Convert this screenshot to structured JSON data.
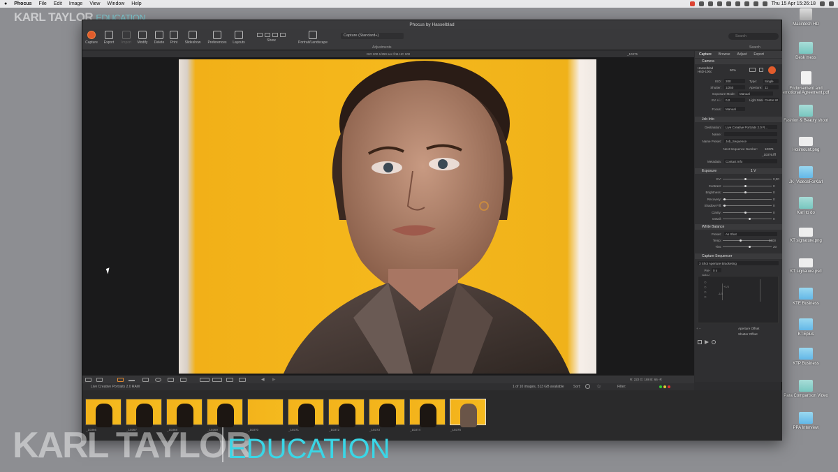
{
  "menubar": {
    "apple": "",
    "app": "Phocus",
    "items": [
      "File",
      "Edit",
      "Image",
      "View",
      "Window",
      "Help"
    ],
    "clock": "Thu 15 Apr  15:26:18"
  },
  "watermark": {
    "top_name": "KARL TAYLOR",
    "top_edu": "EDUCATION",
    "big_name": "KARL TAYLOR",
    "big_edu": "EDUCATION"
  },
  "desktop": [
    {
      "label": "Macintosh HD",
      "kind": "hd"
    },
    {
      "label": "Desk mess",
      "kind": "folder teal"
    },
    {
      "label": "Endorsement and\nemotional Agreement.pdf",
      "kind": "doc"
    },
    {
      "label": "Fashion & Beauty shoot",
      "kind": "folder teal"
    },
    {
      "label": "Holimount.png",
      "kind": "png"
    },
    {
      "label": "JK_VideosForKarl",
      "kind": "folder"
    },
    {
      "label": "Karl to do",
      "kind": "folder teal"
    },
    {
      "label": "KT signature.png",
      "kind": "png"
    },
    {
      "label": "KT signature.psd",
      "kind": "png"
    },
    {
      "label": "KTE Business",
      "kind": "folder"
    },
    {
      "label": "KTEplus",
      "kind": "folder"
    },
    {
      "label": "KTP Business",
      "kind": "folder"
    },
    {
      "label": "Para Comparison Video",
      "kind": "folder teal"
    },
    {
      "label": "PPA Interview",
      "kind": "folder"
    }
  ],
  "window": {
    "title": "Phocus by Hasselblad"
  },
  "toolbar": {
    "buttons": [
      "Capture",
      "Export",
      "Import",
      "Modify",
      "Delete",
      "Print",
      "Slideshow",
      "Preferences",
      "Layouts",
      "Show",
      "Portrait/Landscape"
    ],
    "select": "Capture (Standard+)",
    "adjustments": "Adjustments",
    "search_placeholder": "Search",
    "search_label": "Search"
  },
  "info": {
    "strip": "ISO 200  1/250 sec  f/11  HC 100",
    "image_num": "_10375"
  },
  "panel": {
    "tabs": [
      "Capture",
      "Browse",
      "Adjust",
      "Export"
    ],
    "camera": {
      "title": "Camera",
      "model": "Hasselblad\nH6D-100c",
      "battery": "90%",
      "iso_l": "ISO:",
      "iso": "200",
      "type_l": "Type:",
      "type": "Single",
      "shutter_l": "Shutter:",
      "shutter": "1/250",
      "aperture_l": "Aperture:",
      "aperture": "11",
      "expmode_l": "Exposure Mode:",
      "expmode": "Manual",
      "ev_l": "EV +/-:",
      "ev": "0,0",
      "meter_l": "Light Meter:",
      "meter": "Centre W",
      "focus_l": "Focus:",
      "focus": "Manual"
    },
    "jobinfo": {
      "title": "Job Info",
      "dest_l": "Destination:",
      "dest": "Live Creative Portraits 2.0 R...",
      "name_l": "Name:",
      "nameprov_l": "Name Preset:",
      "nameprov": "Job_Sequence",
      "seq_l": "Next Sequence Number:",
      "seq": "10376",
      "seqname": "_10376.fff",
      "meta_l": "Metadata:",
      "meta": "Contact Info"
    },
    "exposure": {
      "title": "Exposure",
      "mode": "1 V",
      "rows": [
        {
          "l": "EV:",
          "v": "0,00",
          "p": 0.45
        },
        {
          "l": "Contrast:",
          "v": "0",
          "p": 0.45
        },
        {
          "l": "Brightness:",
          "v": "0",
          "p": 0.45
        },
        {
          "l": "Recovery:",
          "v": "0",
          "p": 0.02
        },
        {
          "l": "Shadow Fill:",
          "v": "0",
          "p": 0.02
        },
        {
          "l": "Clarity:",
          "v": "0",
          "p": 0.45
        },
        {
          "l": "Detail:",
          "v": "0",
          "p": 0.55
        }
      ]
    },
    "wb": {
      "title": "White Balance",
      "preset_l": "Preset:",
      "preset": "As Shot",
      "temp_l": "Temp:",
      "temp": "5500",
      "temp_p": 0.35,
      "tint_l": "Tint:",
      "tint": "20",
      "tint_p": 0.55
    },
    "seq": {
      "title": "Capture Sequencer",
      "mode": "3 Shot Aperture Bracketing",
      "delay_l": "Pre-delay:",
      "delay": "0 s",
      "ap_l": "Aperture Offset",
      "sh_l": "Shutter Offset",
      "a1": "+1/3",
      "a2": "-1/3"
    }
  },
  "browser": {
    "folder": "Live Creative Portraits 2.0 RAW",
    "count": "1 of 10 images, 513 GB available",
    "sort": "Sort:",
    "filter": "Filter:",
    "coords": "R: 222  G: 188  B: 66  -R",
    "thumbs": [
      "_10366",
      "_10367",
      "_10368",
      "_10369",
      "_10370",
      "_10371",
      "_10372",
      "_10373",
      "_10374",
      "_10375"
    ]
  }
}
